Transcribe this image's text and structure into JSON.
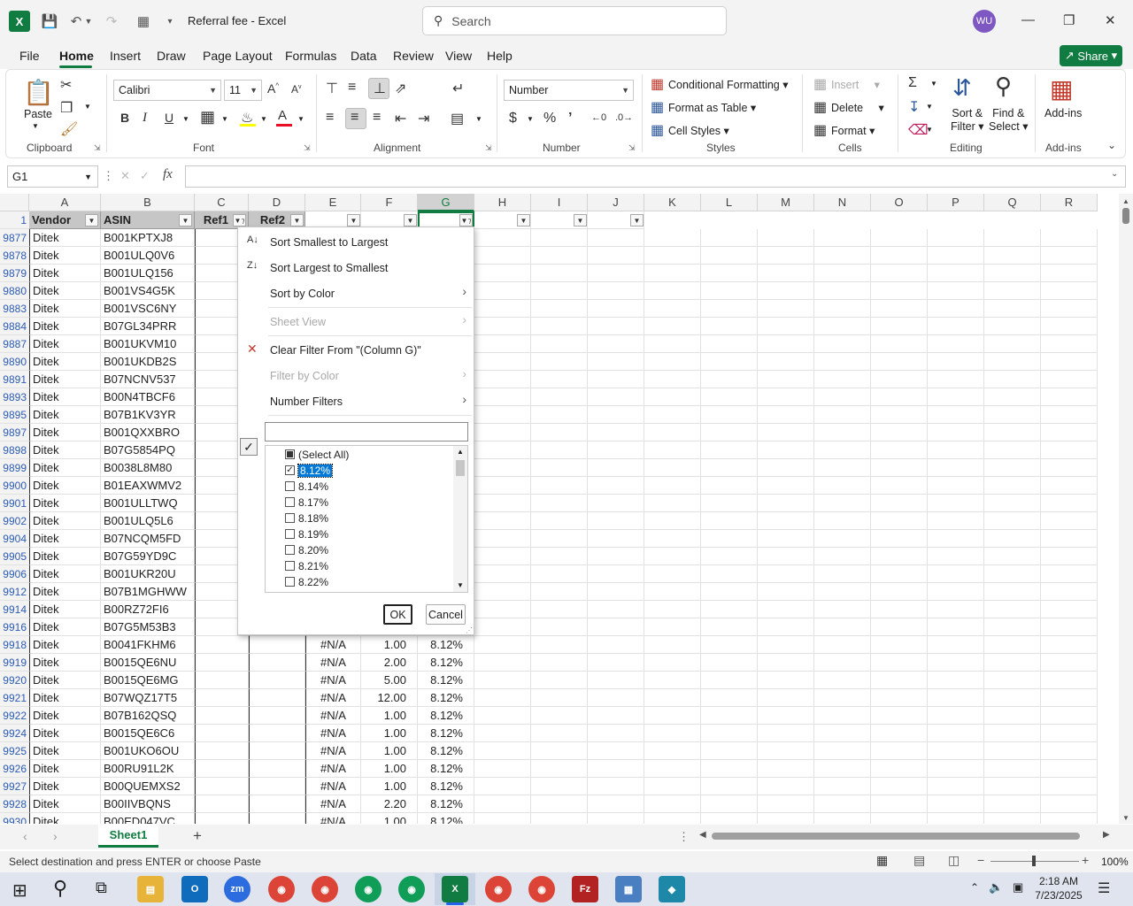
{
  "window": {
    "title": "Referral fee  -  Excel",
    "search_placeholder": "Search",
    "avatar": "WU"
  },
  "menu": [
    "File",
    "Home",
    "Insert",
    "Draw",
    "Page Layout",
    "Formulas",
    "Data",
    "Review",
    "View",
    "Help"
  ],
  "share_label": "Share",
  "ribbon": {
    "clipboard": {
      "paste": "Paste",
      "label": "Clipboard"
    },
    "font": {
      "name": "Calibri",
      "size": "11",
      "label": "Font"
    },
    "alignment": {
      "label": "Alignment"
    },
    "number": {
      "format": "Number",
      "label": "Number"
    },
    "styles": {
      "conditional": "Conditional Formatting",
      "table": "Format as Table",
      "cell_styles": "Cell Styles",
      "label": "Styles"
    },
    "cells": {
      "insert": "Insert",
      "delete": "Delete",
      "format": "Format",
      "label": "Cells"
    },
    "editing": {
      "sort_filter_1": "Sort &",
      "sort_filter_2": "Filter",
      "find_1": "Find &",
      "find_2": "Select",
      "label": "Editing"
    },
    "addins": {
      "addins": "Add-ins",
      "label": "Add-ins"
    }
  },
  "namebox": "G1",
  "columns": [
    "A",
    "B",
    "C",
    "D",
    "E",
    "F",
    "G",
    "H",
    "I",
    "J",
    "K",
    "L",
    "M",
    "N",
    "O",
    "P",
    "Q",
    "R"
  ],
  "header_row": {
    "num": "1",
    "vendor": "Vendor",
    "asin": "ASIN",
    "ref1": "Ref1",
    "ref2": "Ref2"
  },
  "rows": [
    {
      "n": "9877",
      "v": "Ditek",
      "a": "B001KPTXJ8",
      "e": "",
      "f": "",
      "g": ""
    },
    {
      "n": "9878",
      "v": "Ditek",
      "a": "B001ULQ0V6",
      "e": "",
      "f": "",
      "g": ""
    },
    {
      "n": "9879",
      "v": "Ditek",
      "a": "B001ULQ156",
      "e": "",
      "f": "",
      "g": ""
    },
    {
      "n": "9880",
      "v": "Ditek",
      "a": "B001VS4G5K",
      "e": "",
      "f": "",
      "g": ""
    },
    {
      "n": "9883",
      "v": "Ditek",
      "a": "B001VSC6NY",
      "e": "",
      "f": "",
      "g": ""
    },
    {
      "n": "9884",
      "v": "Ditek",
      "a": "B07GL34PRR",
      "e": "",
      "f": "",
      "g": ""
    },
    {
      "n": "9887",
      "v": "Ditek",
      "a": "B001UKVM10",
      "e": "",
      "f": "",
      "g": ""
    },
    {
      "n": "9890",
      "v": "Ditek",
      "a": "B001UKDB2S",
      "e": "",
      "f": "",
      "g": ""
    },
    {
      "n": "9891",
      "v": "Ditek",
      "a": "B07NCNV537",
      "e": "",
      "f": "",
      "g": ""
    },
    {
      "n": "9893",
      "v": "Ditek",
      "a": "B00N4TBCF6",
      "e": "",
      "f": "",
      "g": ""
    },
    {
      "n": "9895",
      "v": "Ditek",
      "a": "B07B1KV3YR",
      "e": "",
      "f": "",
      "g": ""
    },
    {
      "n": "9897",
      "v": "Ditek",
      "a": "B001QXXBRO",
      "e": "",
      "f": "",
      "g": ""
    },
    {
      "n": "9898",
      "v": "Ditek",
      "a": "B07G5854PQ",
      "e": "",
      "f": "",
      "g": ""
    },
    {
      "n": "9899",
      "v": "Ditek",
      "a": "B0038L8M80",
      "e": "",
      "f": "",
      "g": ""
    },
    {
      "n": "9900",
      "v": "Ditek",
      "a": "B01EAXWMV2",
      "e": "",
      "f": "",
      "g": ""
    },
    {
      "n": "9901",
      "v": "Ditek",
      "a": "B001ULLTWQ",
      "e": "",
      "f": "",
      "g": ""
    },
    {
      "n": "9902",
      "v": "Ditek",
      "a": "B001ULQ5L6",
      "e": "",
      "f": "",
      "g": ""
    },
    {
      "n": "9904",
      "v": "Ditek",
      "a": "B07NCQM5FD",
      "e": "",
      "f": "",
      "g": ""
    },
    {
      "n": "9905",
      "v": "Ditek",
      "a": "B07G59YD9C",
      "e": "",
      "f": "",
      "g": ""
    },
    {
      "n": "9906",
      "v": "Ditek",
      "a": "B001UKR20U",
      "e": "",
      "f": "",
      "g": ""
    },
    {
      "n": "9912",
      "v": "Ditek",
      "a": "B07B1MGHWW",
      "e": "",
      "f": "",
      "g": ""
    },
    {
      "n": "9914",
      "v": "Ditek",
      "a": "B00RZ72FI6",
      "e": "",
      "f": "",
      "g": ""
    },
    {
      "n": "9916",
      "v": "Ditek",
      "a": "B07G5M53B3",
      "e": "",
      "f": "",
      "g": ""
    },
    {
      "n": "9918",
      "v": "Ditek",
      "a": "B0041FKHM6",
      "e": "#N/A",
      "f": "1.00",
      "g": "8.12%"
    },
    {
      "n": "9919",
      "v": "Ditek",
      "a": "B0015QE6NU",
      "e": "#N/A",
      "f": "2.00",
      "g": "8.12%"
    },
    {
      "n": "9920",
      "v": "Ditek",
      "a": "B0015QE6MG",
      "e": "#N/A",
      "f": "5.00",
      "g": "8.12%"
    },
    {
      "n": "9921",
      "v": "Ditek",
      "a": "B07WQZ17T5",
      "e": "#N/A",
      "f": "12.00",
      "g": "8.12%"
    },
    {
      "n": "9922",
      "v": "Ditek",
      "a": "B07B162QSQ",
      "e": "#N/A",
      "f": "1.00",
      "g": "8.12%"
    },
    {
      "n": "9924",
      "v": "Ditek",
      "a": "B0015QE6C6",
      "e": "#N/A",
      "f": "1.00",
      "g": "8.12%"
    },
    {
      "n": "9925",
      "v": "Ditek",
      "a": "B001UKO6OU",
      "e": "#N/A",
      "f": "1.00",
      "g": "8.12%"
    },
    {
      "n": "9926",
      "v": "Ditek",
      "a": "B00RU91L2K",
      "e": "#N/A",
      "f": "1.00",
      "g": "8.12%"
    },
    {
      "n": "9927",
      "v": "Ditek",
      "a": "B00QUEMXS2",
      "e": "#N/A",
      "f": "1.00",
      "g": "8.12%"
    },
    {
      "n": "9928",
      "v": "Ditek",
      "a": "B00IIVBQNS",
      "e": "#N/A",
      "f": "2.20",
      "g": "8.12%"
    },
    {
      "n": "9930",
      "v": "Ditek",
      "a": "B00ED047VC",
      "e": "#N/A",
      "f": "1.00",
      "g": "8.12%"
    }
  ],
  "filter_menu": {
    "sort_asc": "Sort Smallest to Largest",
    "sort_desc": "Sort Largest to Smallest",
    "sort_color": "Sort by Color",
    "sheet_view": "Sheet View",
    "clear_filter": "Clear Filter From \"(Column G)\"",
    "filter_color": "Filter by Color",
    "number_filters": "Number Filters",
    "values": [
      {
        "label": "(Select All)",
        "state": "partial"
      },
      {
        "label": "8.12%",
        "state": "checked"
      },
      {
        "label": "8.14%",
        "state": "unchecked"
      },
      {
        "label": "8.17%",
        "state": "unchecked"
      },
      {
        "label": "8.18%",
        "state": "unchecked"
      },
      {
        "label": "8.19%",
        "state": "unchecked"
      },
      {
        "label": "8.20%",
        "state": "unchecked"
      },
      {
        "label": "8.21%",
        "state": "unchecked"
      },
      {
        "label": "8.22%",
        "state": "unchecked"
      }
    ],
    "ok": "OK",
    "cancel": "Cancel"
  },
  "sheet_tab": "Sheet1",
  "status_text": "Select destination and press ENTER or choose Paste",
  "zoom": "100%",
  "clock": {
    "time": "2:18 AM",
    "date": "7/23/2025"
  }
}
